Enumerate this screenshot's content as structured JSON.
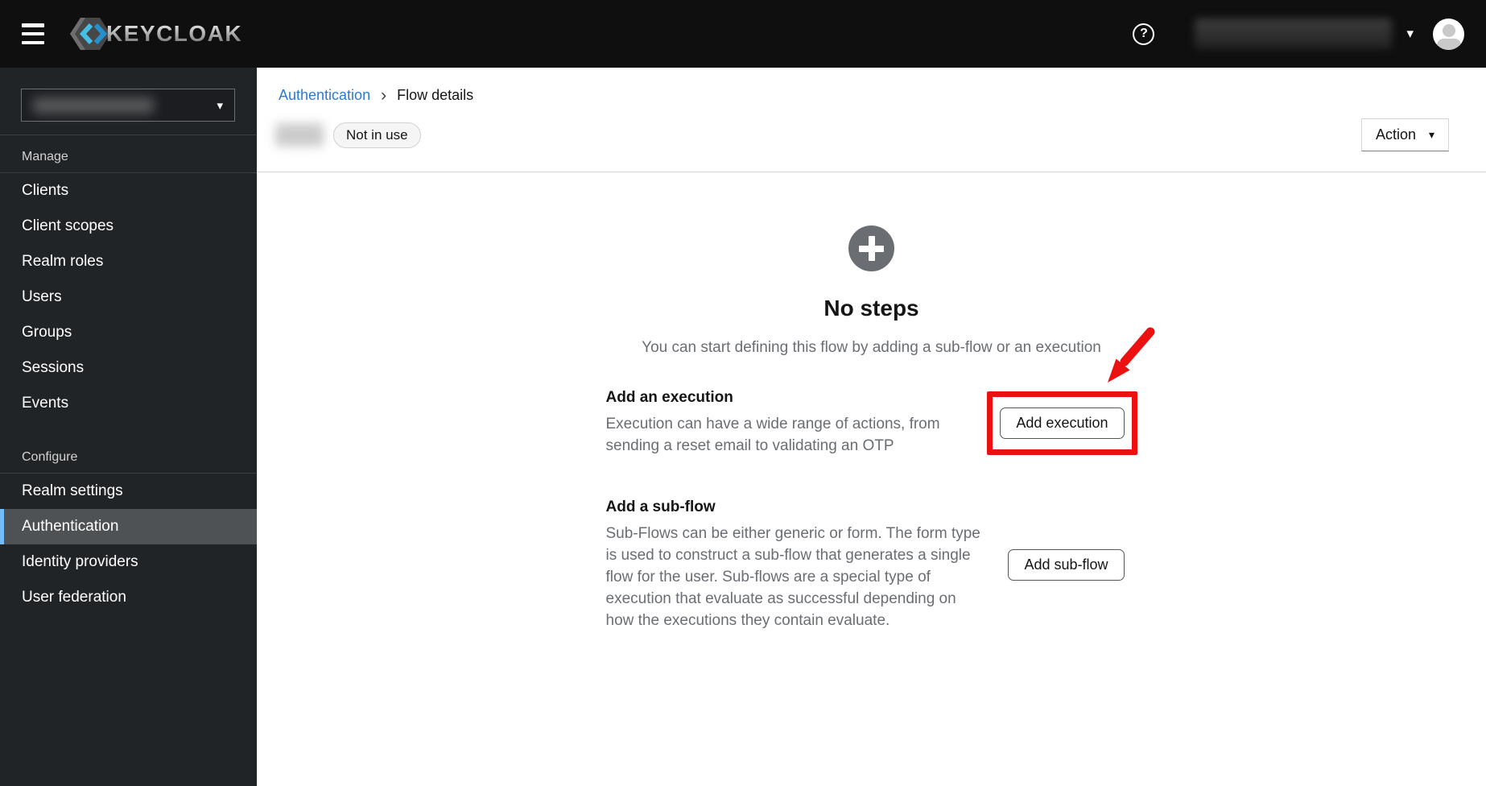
{
  "header": {
    "brand": "KEYCLOAK",
    "help_label": "?"
  },
  "icons": {
    "menu": "hamburger-icon",
    "help": "question-circle-icon",
    "caret_down": "▾",
    "breadcrumb_separator": "›",
    "empty_state": "plus-circle-icon"
  },
  "sidebar": {
    "sections": [
      {
        "label": "Manage",
        "items": [
          "Clients",
          "Client scopes",
          "Realm roles",
          "Users",
          "Groups",
          "Sessions",
          "Events"
        ]
      },
      {
        "label": "Configure",
        "items": [
          "Realm settings",
          "Authentication",
          "Identity providers",
          "User federation"
        ]
      }
    ],
    "selected_item": "Authentication"
  },
  "breadcrumb": {
    "items": [
      "Authentication",
      "Flow details"
    ]
  },
  "page": {
    "status_badge": "Not in use",
    "action_button": "Action"
  },
  "empty_state": {
    "title": "No steps",
    "description": "You can start defining this flow by adding a sub-flow or an execution",
    "options": [
      {
        "heading": "Add an execution",
        "description": "Execution can have a wide range of actions, from sending a reset email to validating an OTP",
        "button": "Add execution",
        "highlighted": true
      },
      {
        "heading": "Add a sub-flow",
        "description": "Sub-Flows can be either generic or form. The form type is used to construct a sub-flow that generates a single flow for the user. Sub-flows are a special type of execution that evaluate as successful depending on how the executions they contain evaluate.",
        "button": "Add sub-flow",
        "highlighted": false
      }
    ]
  },
  "colors": {
    "header_bg": "#0f0f0f",
    "sidebar_bg": "#212427",
    "selected_nav_bg": "#4f5255",
    "selected_nav_accent": "#73bcf7",
    "link_blue": "#2b7bd4",
    "muted_text": "#6a6e73",
    "annotation_red": "#ed1010"
  }
}
